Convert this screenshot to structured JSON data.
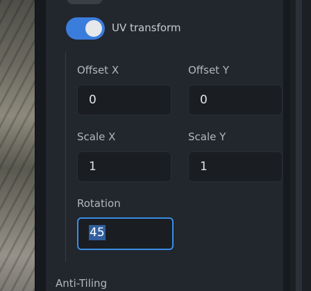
{
  "uv_transform": {
    "label": "UV transform",
    "enabled": true
  },
  "offset_x": {
    "label": "Offset X",
    "value": "0"
  },
  "offset_y": {
    "label": "Offset Y",
    "value": "0"
  },
  "scale_x": {
    "label": "Scale X",
    "value": "1"
  },
  "scale_y": {
    "label": "Scale Y",
    "value": "1"
  },
  "rotation": {
    "label": "Rotation",
    "value": "45"
  },
  "anti_tiling": {
    "label": "Anti-Tiling"
  },
  "colors": {
    "accent": "#3b7ddd",
    "focus_border": "#3a8ee6",
    "card_bg": "#22262d",
    "input_bg": "#1a1d22"
  }
}
